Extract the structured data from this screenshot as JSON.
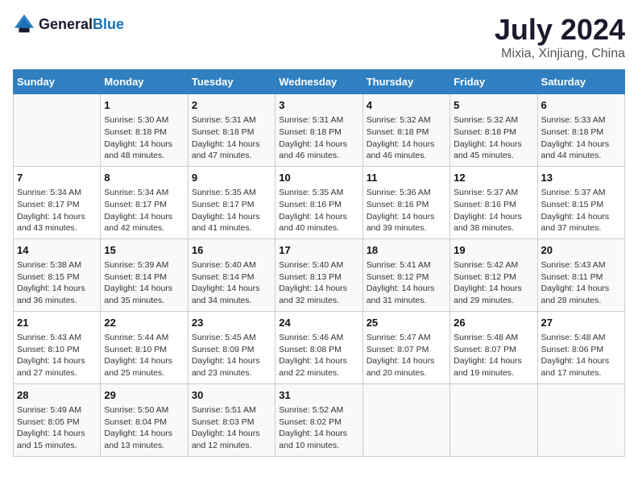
{
  "header": {
    "logo_general": "General",
    "logo_blue": "Blue",
    "month_year": "July 2024",
    "location": "Mixia, Xinjiang, China"
  },
  "days_of_week": [
    "Sunday",
    "Monday",
    "Tuesday",
    "Wednesday",
    "Thursday",
    "Friday",
    "Saturday"
  ],
  "weeks": [
    [
      {
        "day": "",
        "info": ""
      },
      {
        "day": "1",
        "info": "Sunrise: 5:30 AM\nSunset: 8:18 PM\nDaylight: 14 hours\nand 48 minutes."
      },
      {
        "day": "2",
        "info": "Sunrise: 5:31 AM\nSunset: 8:18 PM\nDaylight: 14 hours\nand 47 minutes."
      },
      {
        "day": "3",
        "info": "Sunrise: 5:31 AM\nSunset: 8:18 PM\nDaylight: 14 hours\nand 46 minutes."
      },
      {
        "day": "4",
        "info": "Sunrise: 5:32 AM\nSunset: 8:18 PM\nDaylight: 14 hours\nand 46 minutes."
      },
      {
        "day": "5",
        "info": "Sunrise: 5:32 AM\nSunset: 8:18 PM\nDaylight: 14 hours\nand 45 minutes."
      },
      {
        "day": "6",
        "info": "Sunrise: 5:33 AM\nSunset: 8:18 PM\nDaylight: 14 hours\nand 44 minutes."
      }
    ],
    [
      {
        "day": "7",
        "info": "Sunrise: 5:34 AM\nSunset: 8:17 PM\nDaylight: 14 hours\nand 43 minutes."
      },
      {
        "day": "8",
        "info": "Sunrise: 5:34 AM\nSunset: 8:17 PM\nDaylight: 14 hours\nand 42 minutes."
      },
      {
        "day": "9",
        "info": "Sunrise: 5:35 AM\nSunset: 8:17 PM\nDaylight: 14 hours\nand 41 minutes."
      },
      {
        "day": "10",
        "info": "Sunrise: 5:35 AM\nSunset: 8:16 PM\nDaylight: 14 hours\nand 40 minutes."
      },
      {
        "day": "11",
        "info": "Sunrise: 5:36 AM\nSunset: 8:16 PM\nDaylight: 14 hours\nand 39 minutes."
      },
      {
        "day": "12",
        "info": "Sunrise: 5:37 AM\nSunset: 8:16 PM\nDaylight: 14 hours\nand 38 minutes."
      },
      {
        "day": "13",
        "info": "Sunrise: 5:37 AM\nSunset: 8:15 PM\nDaylight: 14 hours\nand 37 minutes."
      }
    ],
    [
      {
        "day": "14",
        "info": "Sunrise: 5:38 AM\nSunset: 8:15 PM\nDaylight: 14 hours\nand 36 minutes."
      },
      {
        "day": "15",
        "info": "Sunrise: 5:39 AM\nSunset: 8:14 PM\nDaylight: 14 hours\nand 35 minutes."
      },
      {
        "day": "16",
        "info": "Sunrise: 5:40 AM\nSunset: 8:14 PM\nDaylight: 14 hours\nand 34 minutes."
      },
      {
        "day": "17",
        "info": "Sunrise: 5:40 AM\nSunset: 8:13 PM\nDaylight: 14 hours\nand 32 minutes."
      },
      {
        "day": "18",
        "info": "Sunrise: 5:41 AM\nSunset: 8:12 PM\nDaylight: 14 hours\nand 31 minutes."
      },
      {
        "day": "19",
        "info": "Sunrise: 5:42 AM\nSunset: 8:12 PM\nDaylight: 14 hours\nand 29 minutes."
      },
      {
        "day": "20",
        "info": "Sunrise: 5:43 AM\nSunset: 8:11 PM\nDaylight: 14 hours\nand 28 minutes."
      }
    ],
    [
      {
        "day": "21",
        "info": "Sunrise: 5:43 AM\nSunset: 8:10 PM\nDaylight: 14 hours\nand 27 minutes."
      },
      {
        "day": "22",
        "info": "Sunrise: 5:44 AM\nSunset: 8:10 PM\nDaylight: 14 hours\nand 25 minutes."
      },
      {
        "day": "23",
        "info": "Sunrise: 5:45 AM\nSunset: 8:09 PM\nDaylight: 14 hours\nand 23 minutes."
      },
      {
        "day": "24",
        "info": "Sunrise: 5:46 AM\nSunset: 8:08 PM\nDaylight: 14 hours\nand 22 minutes."
      },
      {
        "day": "25",
        "info": "Sunrise: 5:47 AM\nSunset: 8:07 PM\nDaylight: 14 hours\nand 20 minutes."
      },
      {
        "day": "26",
        "info": "Sunrise: 5:48 AM\nSunset: 8:07 PM\nDaylight: 14 hours\nand 19 minutes."
      },
      {
        "day": "27",
        "info": "Sunrise: 5:48 AM\nSunset: 8:06 PM\nDaylight: 14 hours\nand 17 minutes."
      }
    ],
    [
      {
        "day": "28",
        "info": "Sunrise: 5:49 AM\nSunset: 8:05 PM\nDaylight: 14 hours\nand 15 minutes."
      },
      {
        "day": "29",
        "info": "Sunrise: 5:50 AM\nSunset: 8:04 PM\nDaylight: 14 hours\nand 13 minutes."
      },
      {
        "day": "30",
        "info": "Sunrise: 5:51 AM\nSunset: 8:03 PM\nDaylight: 14 hours\nand 12 minutes."
      },
      {
        "day": "31",
        "info": "Sunrise: 5:52 AM\nSunset: 8:02 PM\nDaylight: 14 hours\nand 10 minutes."
      },
      {
        "day": "",
        "info": ""
      },
      {
        "day": "",
        "info": ""
      },
      {
        "day": "",
        "info": ""
      }
    ]
  ]
}
